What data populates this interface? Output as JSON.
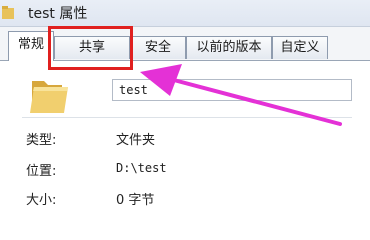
{
  "window": {
    "title": "test 属性"
  },
  "tabs": [
    {
      "label": "常规",
      "active": true
    },
    {
      "label": "共享",
      "active": false
    },
    {
      "label": "安全",
      "active": false
    },
    {
      "label": "以前的版本",
      "active": false
    },
    {
      "label": "自定义",
      "active": false
    }
  ],
  "general": {
    "name_value": "test",
    "properties": [
      {
        "label": "类型:",
        "value": "文件夹"
      },
      {
        "label": "位置:",
        "value": "D:\\test"
      },
      {
        "label": "大小:",
        "value": "0 字节"
      }
    ]
  },
  "annotation": {
    "box_color": "#e0201f",
    "arrow_color": "#e431d6"
  }
}
